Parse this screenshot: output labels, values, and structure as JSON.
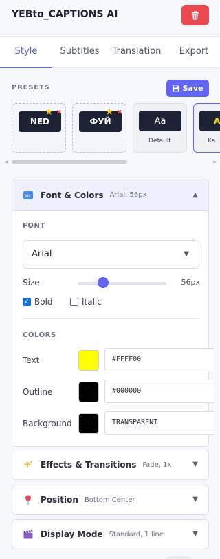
{
  "header": {
    "title": "YEBto_CAPTIONS AI",
    "delete_icon": "trash-icon"
  },
  "tabs": [
    {
      "label": "Style",
      "active": true
    },
    {
      "label": "Subtitles",
      "active": false
    },
    {
      "label": "Translation",
      "active": false
    },
    {
      "label": "Export",
      "active": false
    }
  ],
  "presets": {
    "label": "PRESETS",
    "save_label": "Save",
    "items": [
      {
        "thumb": "NED",
        "custom": true
      },
      {
        "thumb": "ФУЙ",
        "custom": true
      },
      {
        "thumb": "Aa",
        "caption": "Default"
      },
      {
        "thumb": "A",
        "caption": "Ka"
      }
    ]
  },
  "font_panel": {
    "title": "Font & Colors",
    "meta": "Arial, 56px",
    "font_label": "FONT",
    "font_value": "Arial",
    "size_label": "Size",
    "size_value": "56px",
    "size_fraction": 0.29,
    "bold_label": "Bold",
    "bold_checked": true,
    "italic_label": "Italic",
    "italic_checked": false,
    "colors_label": "COLORS",
    "colors": [
      {
        "label": "Text",
        "hex": "#FFFF00",
        "swatch": "#FFFF00"
      },
      {
        "label": "Outline",
        "hex": "#000000",
        "swatch": "#000000"
      },
      {
        "label": "Background",
        "hex": "TRANSPARENT",
        "swatch": "#000000"
      }
    ]
  },
  "effects_panel": {
    "title": "Effects & Transitions",
    "meta": "Fade, 1x"
  },
  "position_panel": {
    "title": "Position",
    "meta": "Bottom Center"
  },
  "display_panel": {
    "title": "Display Mode",
    "meta": "Standard, 1 line"
  },
  "colors": {
    "accent": "#6366f1",
    "danger": "#ea4a4d"
  }
}
